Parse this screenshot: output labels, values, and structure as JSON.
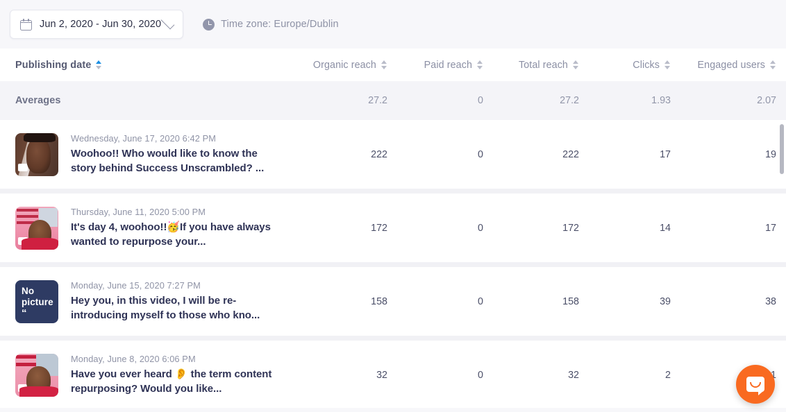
{
  "toolbar": {
    "date_range": "Jun 2, 2020 - Jun 30, 2020",
    "calendar_icon": "calendar-icon",
    "chevron_icon": "chevron-down-icon",
    "clock_icon": "clock-icon",
    "timezone": "Time zone: Europe/Dublin"
  },
  "table": {
    "columns": [
      {
        "label": "Publishing date",
        "sorted": "asc"
      },
      {
        "label": "Organic reach",
        "sorted": "none"
      },
      {
        "label": "Paid reach",
        "sorted": "none"
      },
      {
        "label": "Total reach",
        "sorted": "none"
      },
      {
        "label": "Clicks",
        "sorted": "none"
      },
      {
        "label": "Engaged users",
        "sorted": "none"
      }
    ],
    "averages": {
      "label": "Averages",
      "organic_reach": "27.2",
      "paid_reach": "0",
      "total_reach": "27.2",
      "clicks": "1.93",
      "engaged_users": "2.07"
    },
    "rows": [
      {
        "date": "Wednesday, June 17, 2020 6:42 PM",
        "message": "Woohoo!! Who would like to know the story behind Success Unscrambled? ...",
        "thumbnail": "photo",
        "organic_reach": "222",
        "paid_reach": "0",
        "total_reach": "222",
        "clicks": "17",
        "engaged_users": "19"
      },
      {
        "date": "Thursday, June 11, 2020 5:00 PM",
        "message": "It's day 4, woohoo!!🥳If you have always wanted to repurpose your...",
        "thumbnail": "photo",
        "organic_reach": "172",
        "paid_reach": "0",
        "total_reach": "172",
        "clicks": "14",
        "engaged_users": "17"
      },
      {
        "date": "Monday, June 15, 2020 7:27 PM",
        "message": "Hey you, in this video, I will be re-introducing myself to those who kno...",
        "thumbnail": "no-picture",
        "thumbnail_label": "No picture",
        "organic_reach": "158",
        "paid_reach": "0",
        "total_reach": "158",
        "clicks": "39",
        "engaged_users": "38"
      },
      {
        "date": "Monday, June 8, 2020 6:06 PM",
        "message": "Have you ever heard 👂 the term content repurposing? Would you like...",
        "thumbnail": "photo",
        "organic_reach": "32",
        "paid_reach": "0",
        "total_reach": "32",
        "clicks": "2",
        "engaged_users": "1"
      }
    ]
  },
  "chat_widget": {
    "icon": "chat-bubble-icon",
    "color": "#f96a20"
  },
  "colors": {
    "accent_sort": "#1a8fe3",
    "text_dark": "#2f3356",
    "text_muted": "#8f93a6",
    "page_bg": "#f7f7fa",
    "no_picture_bg": "#2e3b63"
  }
}
